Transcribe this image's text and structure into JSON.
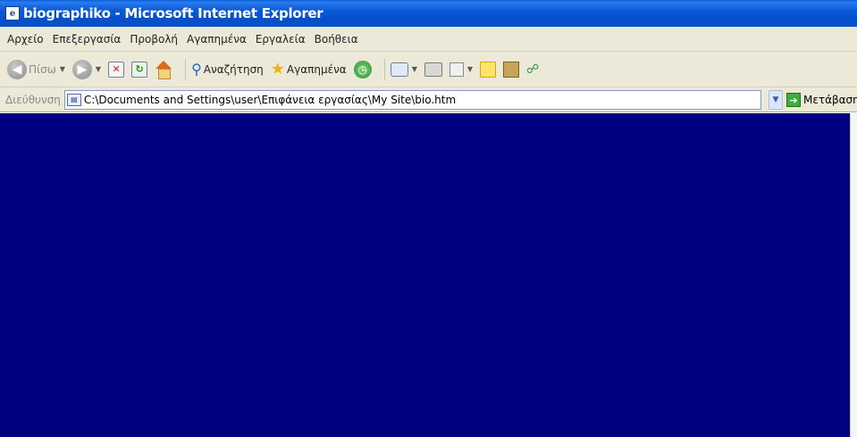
{
  "window": {
    "title": "biographiko - Microsoft Internet Explorer"
  },
  "menu": {
    "items": [
      "Αρχείο",
      "Επεξεργασία",
      "Προβολή",
      "Αγαπημένα",
      "Εργαλεία",
      "Βοήθεια"
    ]
  },
  "toolbar": {
    "back_label": "Πίσω",
    "search_label": "Αναζήτηση",
    "favorites_label": "Αγαπημένα",
    "icons": [
      "back-icon",
      "forward-icon",
      "stop-icon",
      "refresh-icon",
      "home-icon",
      "search-icon",
      "favorites-star-icon",
      "history-icon",
      "mail-icon",
      "print-icon",
      "edit-icon",
      "note-icon",
      "research-icon",
      "messenger-icon"
    ]
  },
  "address": {
    "label": "Διεύθυνση",
    "value": "C:\\Documents and Settings\\user\\Επιφάνεια εργασίας\\My Site\\bio.htm",
    "go_label": "Μετάβαση"
  },
  "page": {
    "background_color": "#000080"
  }
}
